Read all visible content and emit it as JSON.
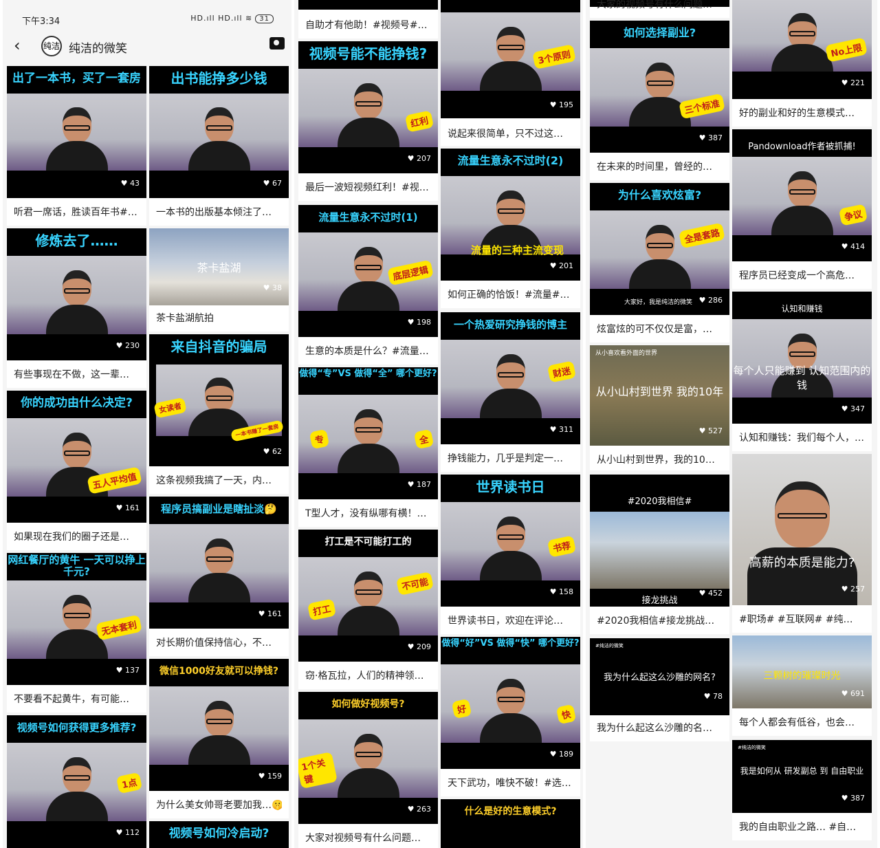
{
  "status": {
    "time": "下午3:34",
    "signal": "HD.ıll HD.ıll ≋",
    "battery": "31"
  },
  "header": {
    "name": "纯洁的微笑",
    "avatar_text": "纯洁"
  },
  "cards": [
    {
      "headline": "出了一本书，买了一套房",
      "likes": "43",
      "caption": "听君一席话，胜读百年书#…"
    },
    {
      "headline": "出书能挣多少钱",
      "likes": "67",
      "caption": "一本书的出版基本倾注了…"
    },
    {
      "headline": "修炼去了……",
      "likes": "230",
      "caption": "有些事现在不做，这一辈…"
    },
    {
      "scene": "茶卡盐湖",
      "likes": "38",
      "caption": "茶卡盐湖航拍"
    },
    {
      "headline": "来自抖音的骗局",
      "sticker": "女读者",
      "sticker2": "一本书赚了一套房",
      "likes": "62",
      "caption": "这条视频我搞了一天，内…"
    },
    {
      "headline": "你的成功由什么决定?",
      "sticker": "五人平均值",
      "likes": "161",
      "caption": "如果现在我们的圈子还是…"
    },
    {
      "headline": "程序员搞副业是瞎扯淡🤔",
      "likes": "161",
      "caption": "对长期价值保持信心，不…"
    },
    {
      "headline": "网红餐厅的黄牛 一天可以挣上千元?",
      "sticker": "无本套利",
      "likes": "137",
      "caption": "不要看不起黄牛，有可能…"
    },
    {
      "headline": "微信1000好友就可以挣钱?",
      "likes": "159",
      "caption": "为什么美女帅哥老要加我…🤫"
    },
    {
      "headline": "视频号如何获得更多推荐?",
      "sticker": "1点",
      "likes": "112",
      "caption": ""
    },
    {
      "headline": "视频号如何冷启动?",
      "caption": ""
    },
    {
      "caption": "自助才有他助！#视频号#…"
    },
    {
      "headline": "视频号能不能挣钱?",
      "sticker": "红利",
      "likes": "207",
      "caption": "最后一波短视频红利！#视…"
    },
    {
      "headline": "流量生意永不过时(1)",
      "sticker": "底层逻辑",
      "likes": "198",
      "caption": "生意的本质是什么？#流量…"
    },
    {
      "headline": "做得“专”VS 做得“全” 哪个更好?",
      "sticker": "专",
      "sticker2": "全",
      "likes": "187",
      "caption": "T型人才，没有纵哪有横！…"
    },
    {
      "headline": "打工是不可能打工的",
      "sticker": "不可能",
      "sticker2": "打工",
      "likes": "209",
      "caption": "窃·格瓦拉，人们的精神领…"
    },
    {
      "headline": "如何做好视频号?",
      "sticker": "1个关键",
      "likes": "263",
      "caption": "大家对视频号有什么问题…"
    },
    {
      "sticker": "3个原则",
      "likes": "195",
      "caption": "说起来很简单，只不过这…"
    },
    {
      "headline": "流量生意永不过时(2)",
      "sticker": "流量的三种主流变现",
      "likes": "201",
      "caption": "如何正确的恰饭！#流量#…"
    },
    {
      "headline": "一个热爱研究挣钱的博主",
      "sticker": "财迷",
      "likes": "311",
      "caption": "挣钱能力，几乎是判定一…"
    },
    {
      "headline": "世界读书日",
      "sticker": "书荐",
      "likes": "158",
      "caption": "世界读书日，欢迎在评论…"
    },
    {
      "headline": "做得“好”VS 做得“快” 哪个更好?",
      "sticker": "好",
      "sticker2": "快",
      "likes": "189",
      "caption": "天下武功，唯快不破！#选…"
    },
    {
      "headline": "什么是好的生意模式?",
      "caption": ""
    },
    {
      "caption": "大家的视频号有什么问题…"
    },
    {
      "headline": "如何选择副业?",
      "sticker": "三个标准",
      "likes": "387",
      "caption": "在未来的时间里，曾经的…"
    },
    {
      "headline": "为什么喜欢炫富?",
      "sticker": "全是套路",
      "footnote": "大家好，我是纯洁的微笑",
      "likes": "286",
      "caption": "炫富炫的可不仅仅是富，…"
    },
    {
      "toptext": "从小喜欢看外面的世界",
      "scene": "从小山村到世界 我的10年",
      "likes": "527",
      "caption": "从小山村到世界，我的10…"
    },
    {
      "toptext": "#2020我相信#",
      "scene": "接龙挑战",
      "likes": "452",
      "caption": "#2020我相信#接龙挑战…"
    },
    {
      "toptext": "#纯洁的微笑",
      "scene": "我为什么起这么沙雕的网名?",
      "likes": "78",
      "caption": "我为什么起这么沙雕的名…"
    },
    {
      "sticker": "No上限",
      "likes": "221",
      "caption": "好的副业和好的生意模式…"
    },
    {
      "toptext": "Pandownload作者被抓捕!",
      "sticker": "争议",
      "likes": "414",
      "caption": "程序员已经变成一个高危…"
    },
    {
      "toptext": "认知和赚钱",
      "scene": "每个人只能赚到 认知范围内的钱",
      "likes": "347",
      "caption": "认知和赚钱：我们每个人，…"
    },
    {
      "scene": "高薪的本质是能力?",
      "likes": "257",
      "caption": "#职场# #互联网# #纯…"
    },
    {
      "scene": "三颗树的璀璨时光",
      "likes": "691",
      "caption": "每个人都会有低谷，也会…"
    },
    {
      "toptext": "#纯洁的微笑",
      "scene": "我是如何从 研发副总 到 自由职业",
      "likes": "387",
      "caption": "我的自由职业之路… #自…"
    }
  ]
}
